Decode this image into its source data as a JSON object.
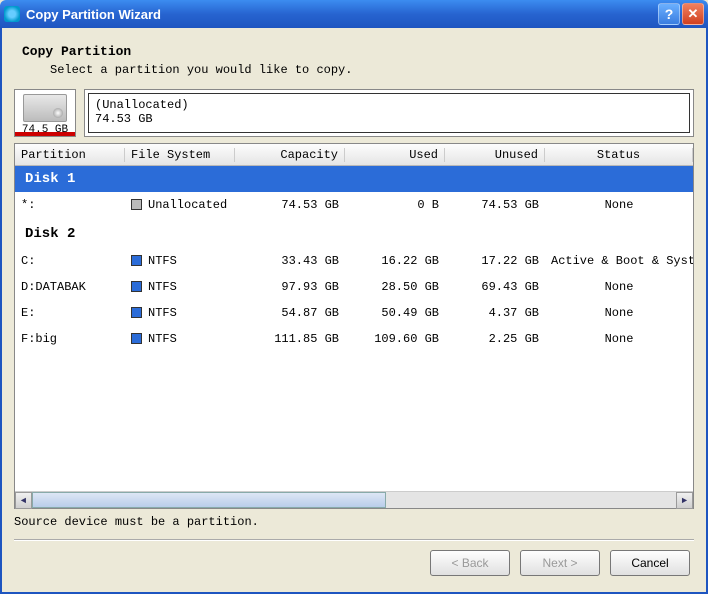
{
  "window": {
    "title": "Copy Partition Wizard"
  },
  "header": {
    "title": "Copy Partition",
    "subtitle": "Select a partition you would like to copy."
  },
  "diskThumb": {
    "size": "74.5 GB"
  },
  "diskBar": {
    "label": "(Unallocated)",
    "size": "74.53 GB"
  },
  "columns": {
    "partition": "Partition",
    "fs": "File System",
    "capacity": "Capacity",
    "used": "Used",
    "unused": "Unused",
    "status": "Status"
  },
  "disks": [
    {
      "name": "Disk 1",
      "highlighted": true,
      "partitions": [
        {
          "name": "*:",
          "fs": "Unallocated",
          "swatch": "gray",
          "capacity": "74.53 GB",
          "used": "0 B",
          "unused": "74.53 GB",
          "status": "None"
        }
      ]
    },
    {
      "name": "Disk 2",
      "highlighted": false,
      "partitions": [
        {
          "name": "C:",
          "fs": "NTFS",
          "swatch": "blue",
          "capacity": "33.43 GB",
          "used": "16.22 GB",
          "unused": "17.22 GB",
          "status": "Active & Boot & System"
        },
        {
          "name": "D:DATABAK",
          "fs": "NTFS",
          "swatch": "blue",
          "capacity": "97.93 GB",
          "used": "28.50 GB",
          "unused": "69.43 GB",
          "status": "None"
        },
        {
          "name": "E:",
          "fs": "NTFS",
          "swatch": "blue",
          "capacity": "54.87 GB",
          "used": "50.49 GB",
          "unused": "4.37 GB",
          "status": "None"
        },
        {
          "name": "F:big",
          "fs": "NTFS",
          "swatch": "blue",
          "capacity": "111.85 GB",
          "used": "109.60 GB",
          "unused": "2.25 GB",
          "status": "None"
        }
      ]
    }
  ],
  "hint": "Source device must be a partition.",
  "buttons": {
    "back": "< Back",
    "next": "Next >",
    "cancel": "Cancel"
  }
}
